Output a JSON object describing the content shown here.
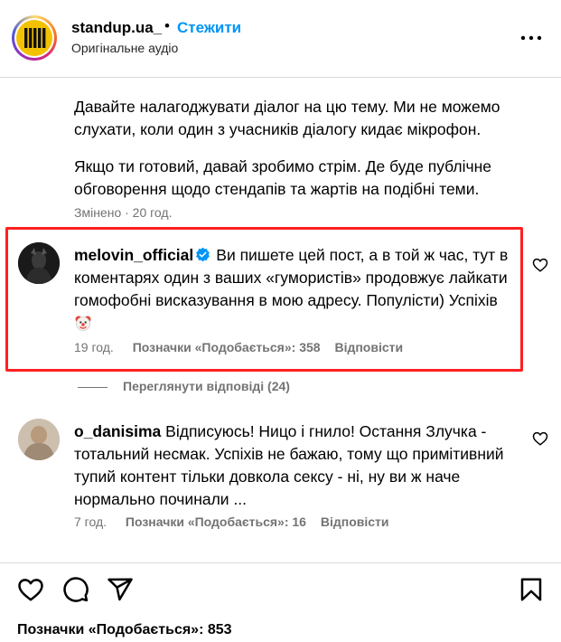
{
  "header": {
    "username": "standup.ua_",
    "dot": "•",
    "follow_label": "Стежити",
    "audio_label": "Оригінальне аудіо"
  },
  "caption": {
    "paragraph1": "Давайте налагоджувати діалог на цю тему. Ми не можемо слухати, коли один з учасників діалогу кидає мікрофон.",
    "paragraph2": "Якщо ти готовий, давай зробимо стрім. Де буде публічне обговорення щодо стендапів та жартів на подібні теми.",
    "edited": "Змінено · 20 год."
  },
  "comments": [
    {
      "username": "melovin_official",
      "verified": true,
      "text": "Ви пишете цей пост, а в той ж час, тут в коментарях один з ваших «гумористів» продовжує лайкати гомофобні висказування в мою адресу. Популісти) Успіхів",
      "emoji": "clown-face-icon",
      "time": "19 год.",
      "likes": "Позначки «Подобається»: 358",
      "reply_label": "Відповісти"
    },
    {
      "username": "o_danisima",
      "verified": false,
      "text": "Відписуюсь! Ницо і гнило! Остання Злучка - тотальний несмак. Успіхів не бажаю, тому що примітивний тупий контент тільки довкола сексу - ні, ну ви ж наче нормально починали ...",
      "time": "7 год.",
      "likes": "Позначки «Подобається»: 16",
      "reply_label": "Відповісти"
    }
  ],
  "view_replies": "Переглянути відповіді (24)",
  "actions": {
    "icons": [
      "heart-icon",
      "comment-icon",
      "share-icon",
      "bookmark-icon"
    ],
    "likes": "Позначки «Подобається»: 853"
  },
  "colors": {
    "accent": "#0095f6",
    "highlight": "#ff2020",
    "muted": "#737373",
    "divider": "#dbdbdb"
  }
}
